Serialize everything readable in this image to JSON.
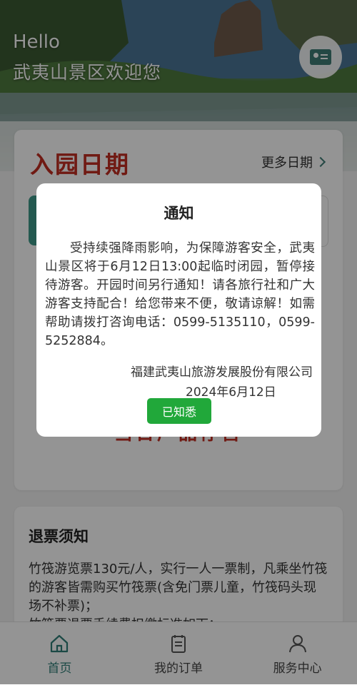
{
  "hero": {
    "greeting": "Hello",
    "welcome": "武夷山景区欢迎您"
  },
  "date_card": {
    "title": "入园日期",
    "more_dates": "更多日期",
    "closed_text": "当日产品停售"
  },
  "refund_card": {
    "title": "退票须知",
    "line1": "竹筏游览票130元/人，实行一人一票制，凡乘坐竹筏的游客皆需购买竹筏票(含免门票儿童，竹筏码头现场不补票)；",
    "line2": "竹筏票退票手续费扣缴标准如下："
  },
  "modal": {
    "title": "通知",
    "body": "受持续强降雨影响，为保障游客安全，武夷山景区将于6月12日13:00起临时闭园，暂停接待游客。开园时间另行通知！请各旅行社和广大游客支持配合！给您带来不便，敬请谅解！如需帮助请拨打咨询电话：0599-5135110，0599-5252884。",
    "org": "福建武夷山旅游发展股份有限公司",
    "date": "2024年6月12日",
    "ack_label": "已知悉"
  },
  "tabbar": {
    "items": [
      {
        "label": "首页",
        "icon": "home-icon",
        "active": true
      },
      {
        "label": "我的订单",
        "icon": "order-icon",
        "active": false
      },
      {
        "label": "服务中心",
        "icon": "user-icon",
        "active": false
      }
    ]
  },
  "colors": {
    "accent": "#2f7f78",
    "title_red": "#c22d22",
    "ack_green": "#21a83a"
  }
}
